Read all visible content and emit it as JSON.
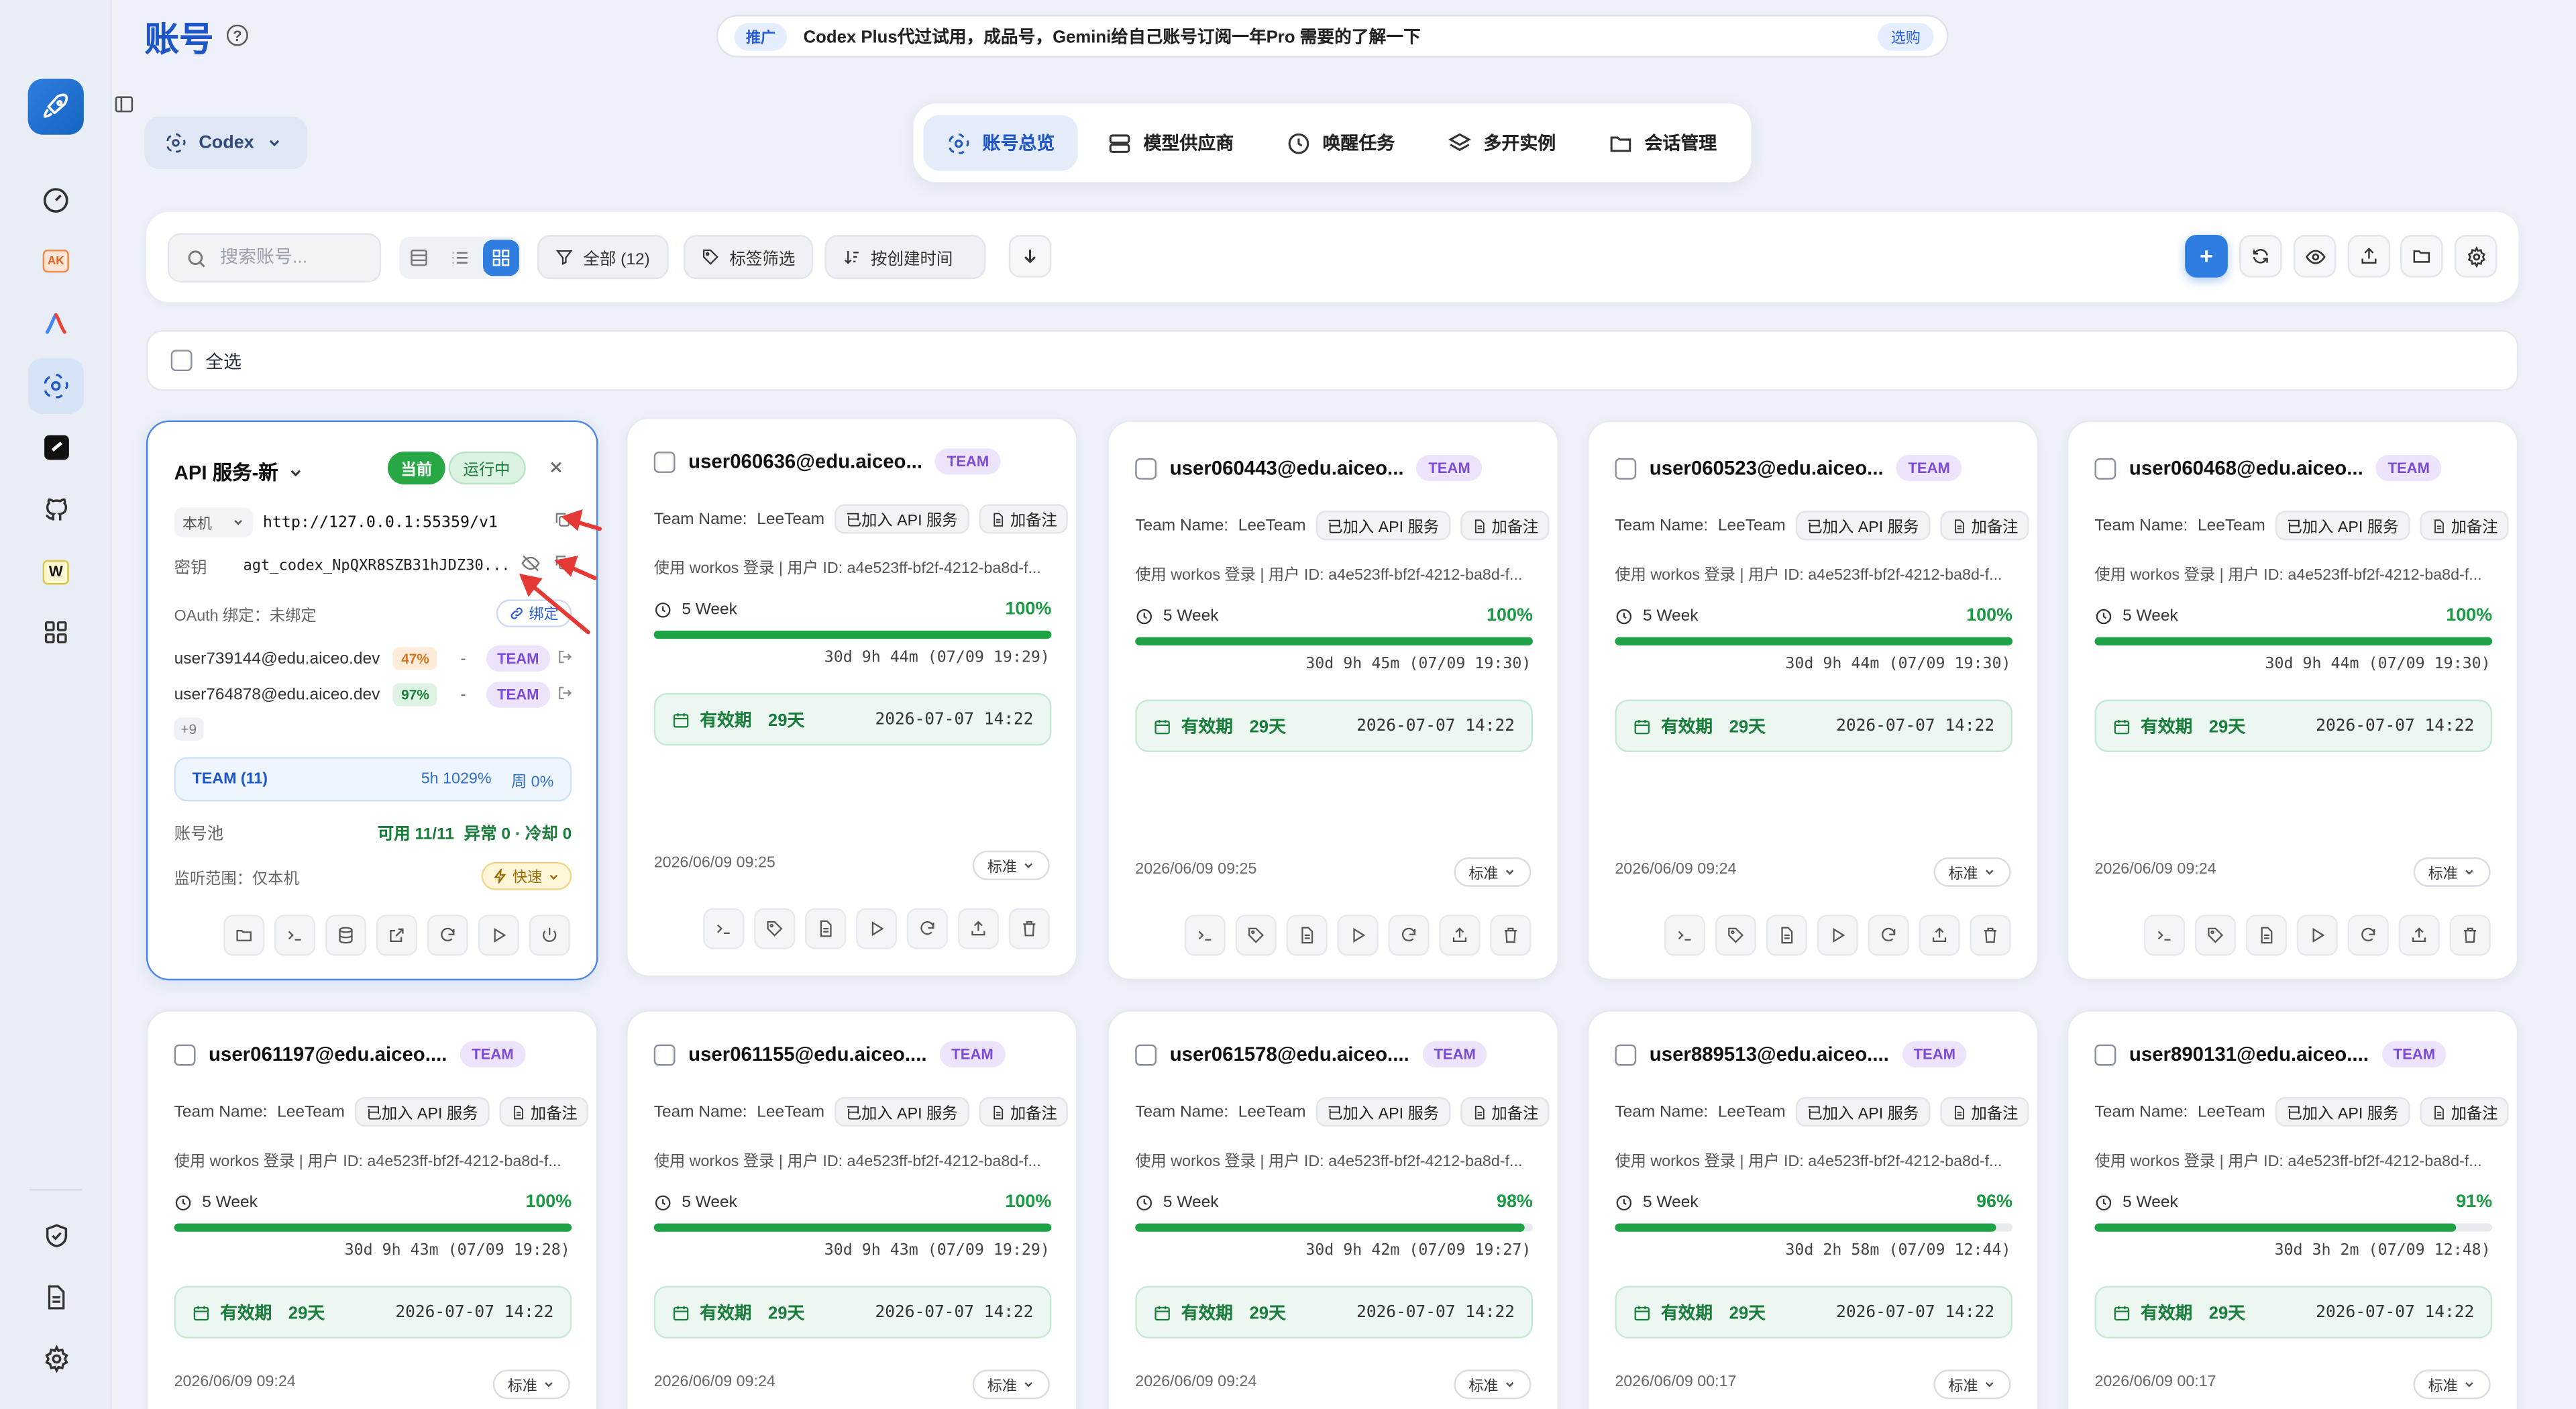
{
  "window": {
    "controls": [
      "close",
      "minimize",
      "maximize"
    ]
  },
  "header": {
    "title": "账号",
    "promo_tag": "推广",
    "promo_text": "Codex Plus代过试用，成品号，Gemini给自己账号订阅一年Pro 需要的了解一下",
    "promo_link": "选购",
    "platform": "Codex"
  },
  "nav": {
    "tabs": [
      {
        "label": "账号总览",
        "icon": "openai-icon",
        "active": true
      },
      {
        "label": "模型供应商",
        "icon": "server-icon",
        "active": false
      },
      {
        "label": "唤醒任务",
        "icon": "clock-icon",
        "active": false
      },
      {
        "label": "多开实例",
        "icon": "layers-icon",
        "active": false
      },
      {
        "label": "会话管理",
        "icon": "folder-icon",
        "active": false
      }
    ]
  },
  "toolbar": {
    "search_placeholder": "搜索账号...",
    "filter_all": "全部 (12)",
    "tag_filter": "标签筛选",
    "sort": "按创建时间"
  },
  "select_all": "全选",
  "api_card": {
    "title": "API 服务-新",
    "current": "当前",
    "running": "运行中",
    "host_label": "本机",
    "url": "http://127.0.0.1:55359/v1",
    "key_label": "密钥",
    "key": "agt_codex_NpQXR8SZB31hJDZ30...",
    "oauth": "OAuth 绑定：未绑定",
    "bind": "绑定",
    "accounts": [
      {
        "email": "user739144@edu.aiceo.dev",
        "pct": "47%",
        "dash": "-",
        "team": "TEAM"
      },
      {
        "email": "user764878@edu.aiceo.dev",
        "pct": "97%",
        "dash": "-",
        "team": "TEAM"
      }
    ],
    "more": "+9",
    "team_box_label": "TEAM (11)",
    "team_box_5h": "5h 1029%",
    "team_box_week": "周 0%",
    "pool_label": "账号池",
    "pool_available": "可用 11/11",
    "pool_status": "异常 0 · 冷却 0",
    "scope": "监听范围：仅本机",
    "speed": "快速"
  },
  "accounts": [
    {
      "email": "user060636@edu.aiceo...",
      "team": "TEAM",
      "team_name_label": "Team Name:",
      "team_name": "LeeTeam",
      "api_chip": "已加入 API 服务",
      "note_chip": "加备注",
      "login": "使用 workos 登录 | 用户 ID: a4e523ff-bf2f-4212-ba8d-f...",
      "quota_label": "5 Week",
      "quota_pct": "100%",
      "quota_value": 100,
      "reset": "30d 9h 44m (07/09 19:29)",
      "valid_label": "有效期",
      "valid_days": "29天",
      "valid_date": "2026-07-07 14:22",
      "created": "2026/06/09 09:25",
      "tier": "标准"
    },
    {
      "email": "user060443@edu.aiceo...",
      "team": "TEAM",
      "team_name_label": "Team Name:",
      "team_name": "LeeTeam",
      "api_chip": "已加入 API 服务",
      "note_chip": "加备注",
      "login": "使用 workos 登录 | 用户 ID: a4e523ff-bf2f-4212-ba8d-f...",
      "quota_label": "5 Week",
      "quota_pct": "100%",
      "quota_value": 100,
      "reset": "30d 9h 45m (07/09 19:30)",
      "valid_label": "有效期",
      "valid_days": "29天",
      "valid_date": "2026-07-07 14:22",
      "created": "2026/06/09 09:25",
      "tier": "标准"
    },
    {
      "email": "user060523@edu.aiceo...",
      "team": "TEAM",
      "team_name_label": "Team Name:",
      "team_name": "LeeTeam",
      "api_chip": "已加入 API 服务",
      "note_chip": "加备注",
      "login": "使用 workos 登录 | 用户 ID: a4e523ff-bf2f-4212-ba8d-f...",
      "quota_label": "5 Week",
      "quota_pct": "100%",
      "quota_value": 100,
      "reset": "30d 9h 44m (07/09 19:30)",
      "valid_label": "有效期",
      "valid_days": "29天",
      "valid_date": "2026-07-07 14:22",
      "created": "2026/06/09 09:24",
      "tier": "标准"
    },
    {
      "email": "user060468@edu.aiceo...",
      "team": "TEAM",
      "team_name_label": "Team Name:",
      "team_name": "LeeTeam",
      "api_chip": "已加入 API 服务",
      "note_chip": "加备注",
      "login": "使用 workos 登录 | 用户 ID: a4e523ff-bf2f-4212-ba8d-f...",
      "quota_label": "5 Week",
      "quota_pct": "100%",
      "quota_value": 100,
      "reset": "30d 9h 44m (07/09 19:30)",
      "valid_label": "有效期",
      "valid_days": "29天",
      "valid_date": "2026-07-07 14:22",
      "created": "2026/06/09 09:24",
      "tier": "标准"
    },
    {
      "email": "user061197@edu.aiceo....",
      "team": "TEAM",
      "team_name_label": "Team Name:",
      "team_name": "LeeTeam",
      "api_chip": "已加入 API 服务",
      "note_chip": "加备注",
      "login": "使用 workos 登录 | 用户 ID: a4e523ff-bf2f-4212-ba8d-f...",
      "quota_label": "5 Week",
      "quota_pct": "100%",
      "quota_value": 100,
      "reset": "30d 9h 43m (07/09 19:28)",
      "valid_label": "有效期",
      "valid_days": "29天",
      "valid_date": "2026-07-07 14:22",
      "created": "2026/06/09 09:24",
      "tier": "标准"
    },
    {
      "email": "user061155@edu.aiceo....",
      "team": "TEAM",
      "team_name_label": "Team Name:",
      "team_name": "LeeTeam",
      "api_chip": "已加入 API 服务",
      "note_chip": "加备注",
      "login": "使用 workos 登录 | 用户 ID: a4e523ff-bf2f-4212-ba8d-f...",
      "quota_label": "5 Week",
      "quota_pct": "100%",
      "quota_value": 100,
      "reset": "30d 9h 43m (07/09 19:29)",
      "valid_label": "有效期",
      "valid_days": "29天",
      "valid_date": "2026-07-07 14:22",
      "created": "2026/06/09 09:24",
      "tier": "标准"
    },
    {
      "email": "user061578@edu.aiceo....",
      "team": "TEAM",
      "team_name_label": "Team Name:",
      "team_name": "LeeTeam",
      "api_chip": "已加入 API 服务",
      "note_chip": "加备注",
      "login": "使用 workos 登录 | 用户 ID: a4e523ff-bf2f-4212-ba8d-f...",
      "quota_label": "5 Week",
      "quota_pct": "98%",
      "quota_value": 98,
      "reset": "30d 9h 42m (07/09 19:27)",
      "valid_label": "有效期",
      "valid_days": "29天",
      "valid_date": "2026-07-07 14:22",
      "created": "2026/06/09 09:24",
      "tier": "标准"
    },
    {
      "email": "user889513@edu.aiceo....",
      "team": "TEAM",
      "team_name_label": "Team Name:",
      "team_name": "LeeTeam",
      "api_chip": "已加入 API 服务",
      "note_chip": "加备注",
      "login": "使用 workos 登录 | 用户 ID: a4e523ff-bf2f-4212-ba8d-f...",
      "quota_label": "5 Week",
      "quota_pct": "96%",
      "quota_value": 96,
      "reset": "30d 2h 58m (07/09 12:44)",
      "valid_label": "有效期",
      "valid_days": "29天",
      "valid_date": "2026-07-07 14:22",
      "created": "2026/06/09 00:17",
      "tier": "标准"
    },
    {
      "email": "user890131@edu.aiceo....",
      "team": "TEAM",
      "team_name_label": "Team Name:",
      "team_name": "LeeTeam",
      "api_chip": "已加入 API 服务",
      "note_chip": "加备注",
      "login": "使用 workos 登录 | 用户 ID: a4e523ff-bf2f-4212-ba8d-f...",
      "quota_label": "5 Week",
      "quota_pct": "91%",
      "quota_value": 91,
      "reset": "30d 3h 2m (07/09 12:48)",
      "valid_label": "有效期",
      "valid_days": "29天",
      "valid_date": "2026-07-07 14:22",
      "created": "2026/06/09 00:17",
      "tier": "标准"
    }
  ],
  "colors": {
    "accent": "#2f7de1",
    "title_blue": "#1e56c7",
    "progress_green": "#1fa347",
    "team_purple": "#7b4ad9",
    "annotation_red": "#e53935"
  }
}
